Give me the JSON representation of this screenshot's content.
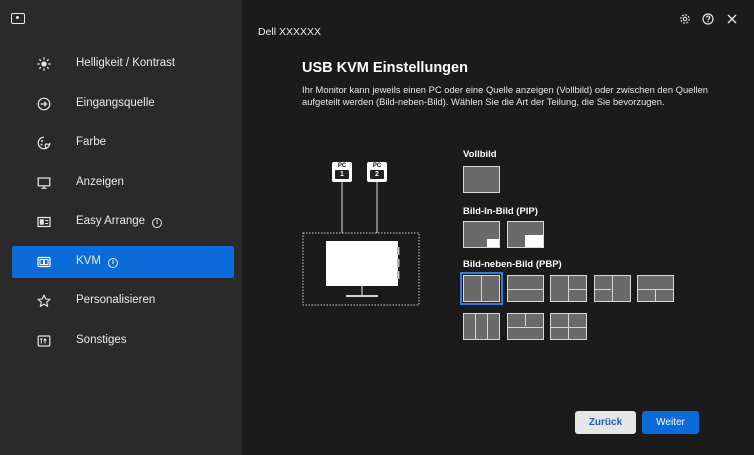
{
  "header": {
    "window_title": "Dell XXXXXX"
  },
  "sidebar": {
    "items": [
      {
        "label": "Helligkeit / Kontrast",
        "icon": "brightness-icon"
      },
      {
        "label": "Eingangsquelle",
        "icon": "input-source-icon"
      },
      {
        "label": "Farbe",
        "icon": "color-icon"
      },
      {
        "label": "Anzeigen",
        "icon": "display-icon"
      },
      {
        "label": "Easy Arrange",
        "icon": "easy-arrange-icon",
        "info": "i"
      },
      {
        "label": "KVM",
        "icon": "kvm-icon",
        "info": "i",
        "active": true
      },
      {
        "label": "Personalisieren",
        "icon": "star-icon"
      },
      {
        "label": "Sonstiges",
        "icon": "others-icon"
      }
    ]
  },
  "main": {
    "title": "USB KVM Einstellungen",
    "description": "Ihr Monitor kann jeweils einen PC oder eine Quelle anzeigen (Vollbild) oder zwischen den Quellen aufgeteilt werden (Bild-neben-Bild). Wählen Sie die Art der Teilung, die Sie bevorzugen.",
    "illustration": {
      "pc1_label": "PC",
      "pc1_number": "1",
      "pc2_label": "PC",
      "pc2_number": "2"
    },
    "sections": {
      "full": "Vollbild",
      "pip": "Bild-In-Bild (PIP)",
      "pbp": "Bild-neben-Bild (PBP)"
    },
    "selected_layout": "pbp-2-vertical"
  },
  "footer": {
    "back_label": "Zurück",
    "next_label": "Weiter"
  },
  "colors": {
    "accent": "#0b6bd8",
    "sidebar_bg": "#2a2a2a",
    "main_bg": "#1b1b1b"
  }
}
